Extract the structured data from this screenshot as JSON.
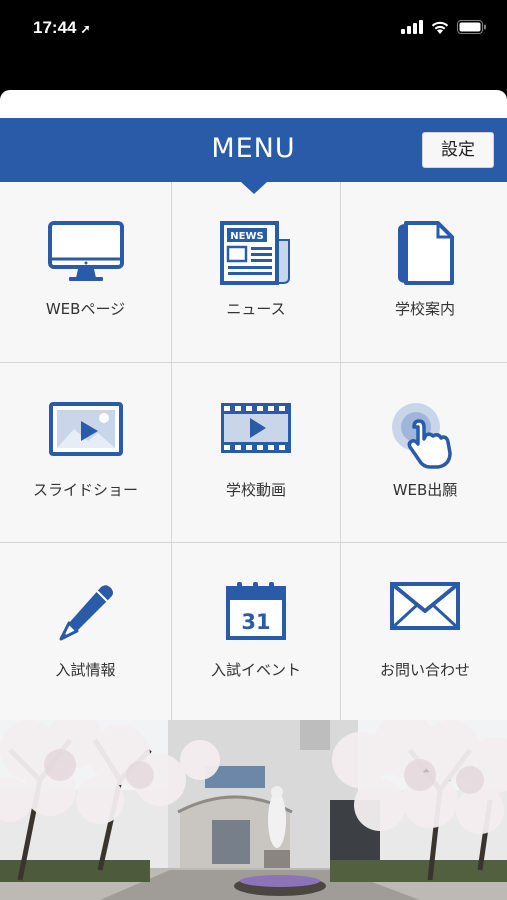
{
  "status_bar": {
    "time": "17:44"
  },
  "header": {
    "title": "MENU",
    "settings_label": "設定"
  },
  "menu_items": [
    {
      "label": "WEBページ",
      "icon": "monitor-icon"
    },
    {
      "label": "ニュース",
      "icon": "newspaper-icon",
      "icon_text": "NEWS"
    },
    {
      "label": "学校案内",
      "icon": "book-icon"
    },
    {
      "label": "スライドショー",
      "icon": "slideshow-icon"
    },
    {
      "label": "学校動画",
      "icon": "video-icon"
    },
    {
      "label": "WEB出願",
      "icon": "tap-hand-icon"
    },
    {
      "label": "入試情報",
      "icon": "pencil-icon"
    },
    {
      "label": "入試イベント",
      "icon": "calendar-icon",
      "icon_text": "31"
    },
    {
      "label": "お問い合わせ",
      "icon": "envelope-icon"
    }
  ],
  "colors": {
    "accent": "#2a5ba8",
    "icon": "#2a5ba8"
  }
}
